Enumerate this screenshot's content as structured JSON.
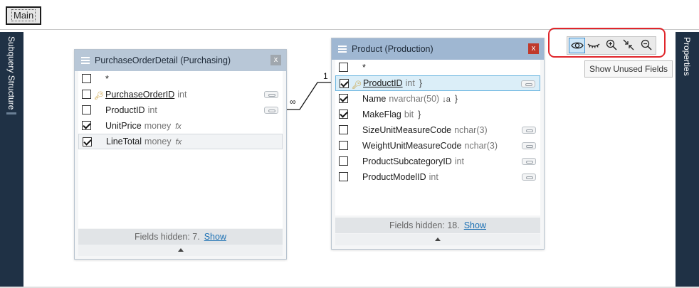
{
  "tabs": {
    "main_label": "Main"
  },
  "side_panels": {
    "left_label": "Subquery Structure",
    "right_label": "Properties"
  },
  "relation": {
    "one_label": "1",
    "many_label": "∞"
  },
  "tables": [
    {
      "title": "PurchaseOrderDetail (Purchasing)",
      "close": "x",
      "rows": [
        {
          "name": "*",
          "type": "",
          "checked": false
        },
        {
          "name": "PurchaseOrderID",
          "type": "int",
          "checked": false,
          "key": true
        },
        {
          "name": "ProductID",
          "type": "int",
          "checked": false
        },
        {
          "name": "UnitPrice",
          "type": "money",
          "checked": true,
          "fx": "fx"
        },
        {
          "name": "LineTotal",
          "type": "money",
          "checked": true,
          "fx": "fx"
        }
      ],
      "footer": {
        "text": "Fields hidden: 7.",
        "link": "Show"
      }
    },
    {
      "title": "Product (Production)",
      "close": "x",
      "rows": [
        {
          "name": "*",
          "type": "",
          "checked": false
        },
        {
          "name": "ProductID",
          "type": "int",
          "checked": true,
          "key": true,
          "brace": "}"
        },
        {
          "name": "Name",
          "type": "nvarchar(50)",
          "checked": true,
          "brace": "}",
          "sort": "↓a"
        },
        {
          "name": "MakeFlag",
          "type": "bit",
          "checked": true,
          "brace": "}"
        },
        {
          "name": "SizeUnitMeasureCode",
          "type": "nchar(3)",
          "checked": false
        },
        {
          "name": "WeightUnitMeasureCode",
          "type": "nchar(3)",
          "checked": false
        },
        {
          "name": "ProductSubcategoryID",
          "type": "int",
          "checked": false
        },
        {
          "name": "ProductModelID",
          "type": "int",
          "checked": false
        }
      ],
      "footer": {
        "text": "Fields hidden: 18.",
        "link": "Show"
      }
    }
  ],
  "toolbar": {
    "buttons": [
      "eye-icon",
      "closed-eye-icon",
      "zoom-in-icon",
      "fit-icon",
      "zoom-out-icon"
    ],
    "tooltip": "Show Unused Fields",
    "highlight_color": "#e0262b"
  }
}
